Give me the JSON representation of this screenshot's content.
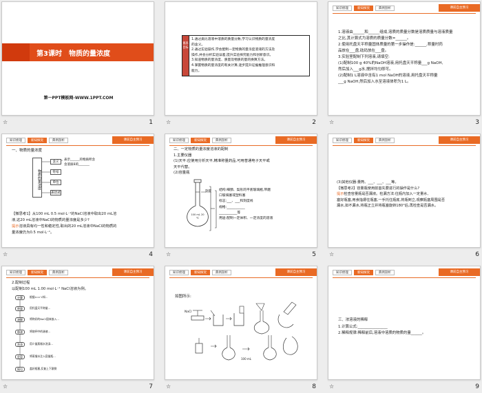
{
  "slides": [
    {
      "num": "1",
      "title": "第3课时　物质的量浓度",
      "credit": "第一PPT模板网-WWW.1PPT.COM"
    },
    {
      "num": "2",
      "side_label": "素养目标",
      "lines": [
        "1.通过类比溶液中溶质的质量分数,学习认识物质的量浓度",
        "的含义。",
        "2.通过实验操作,学会配制一定物质的量浓度溶液的方法及",
        "操作,并会分析实验误差,提升实验探究能力和创新意识。",
        "3.知道物质的量浓度、质量及物质的量的换算方法。",
        "4.掌握物质的量浓度的有关计算,逐步提升证据推理意识和",
        "能力。"
      ]
    },
    {
      "num": "3",
      "lines": [
        "1.溶液由______和______组成,溶质的质量分数是溶质质量与溶液质量",
        "之比,其计算式为溶质的质量分数=______。",
        "2.使用托盘天平称量固体质量的第一步操作是:______,称量时药",
        "品放在___盘,砝码放在___盘。",
        "3.实验室配制下列溶液,请填空:",
        "(1)配制100 g 40%的NaOH溶液,用托盘天平称量___g NaOH,",
        "然后加入___g水,搅拌均匀即可。",
        "(2)配制1 L溶液中含有1 mol NaOH的溶液,用托盘天平称量",
        "___g NaOH,然后加入水至溶液体积为1 L。"
      ]
    },
    {
      "num": "4",
      "heading": "一、物质的量浓度",
      "diagram_center": "物质的量浓度",
      "diagram_rows": [
        "含义",
        "符号",
        "单位",
        "表达式"
      ],
      "row_notes": [
        "表示______的物质所含",
        "含溶质B的_______",
        "",
        ""
      ],
      "think": "【微思考1】从100 mL 0.5 mol·L⁻¹的NaCl溶液中取出20 mL溶",
      "think2": "液,这20 mL溶液中NaCl的物质的量浓度是多少?",
      "hint": "提示",
      "hint_rest": "溶液具有均一性和稳定性,取出的20 mL溶液中NaCl的物质的",
      "hint2": "量浓度仍为0.5 mol·L⁻¹。"
    },
    {
      "num": "5",
      "heading": "二、一定物质的量浓度溶液的配制",
      "sub": "1.主要仪器",
      "l1": "(1)天平:应使用分析天平,精准称量药品,可用普通电子天平或",
      "l2": "天平代替。",
      "l3": "(2)容量瓶",
      "flask_label": "刻度",
      "flask_text": "100 mL 20 ℃",
      "notes": [
        "结构:细颈、梨形的平底玻璃瓶,带磨",
        "口玻璃塞或塑料塞",
        "标志:___、___和刻度线",
        "规格:___________",
        "___________等",
        "用途:配制一定体积、一定浓度的溶液"
      ]
    },
    {
      "num": "6",
      "l1": "(3)其他仪器:量筒、___、___、___等。",
      "think": "【微思考2】容量瓶使用前首先要进行的操作是什么?",
      "hint": "提示",
      "hint_rest": "检查容量瓶是否漏液。检漏方法:往瓶内加入一定量水,",
      "hint2": "塞好瓶塞,用食指摁住瓶塞,一手托住瓶底,将瓶倒立,观察瓶塞周围是否",
      "hint3": "漏水,如不漏水,将瓶正立并将瓶塞旋转180°后,再检查是否漏水。"
    },
    {
      "num": "7",
      "sub": "2.配制过程",
      "l1": "以配制100 mL 1.00 mol·L⁻¹ NaCl溶液为例。",
      "steps": [
        "计算",
        "称量",
        "溶解",
        "移液",
        "洗涤",
        "定容",
        "摇匀"
      ],
      "step_notes": [
        "根据n=c·V知...",
        "用托盘天平称量...",
        "将称好的NaCl固体放入...",
        "将烧杯中的溶液...",
        "用少量蒸馏水洗涤...",
        "将蒸馏水注入容量瓶...",
        "盖好瓶塞,反复上下颠倒"
      ]
    },
    {
      "num": "8",
      "l1": "如图所示:",
      "label_nacl": "NaCl",
      "label_vol": "100 mL"
    },
    {
      "num": "9",
      "heading": "三、浓溶液的稀释",
      "l1": "1.计算公式:________________",
      "l2": "2.稀释规律:稀释前后,溶液中溶质的物质的量______。"
    }
  ],
  "common": {
    "tab_1": "知识梳理",
    "tab_2": "新知探究",
    "tab_3": "典例剖析",
    "banner": "课前自主预习"
  },
  "cell_marker": "☆"
}
